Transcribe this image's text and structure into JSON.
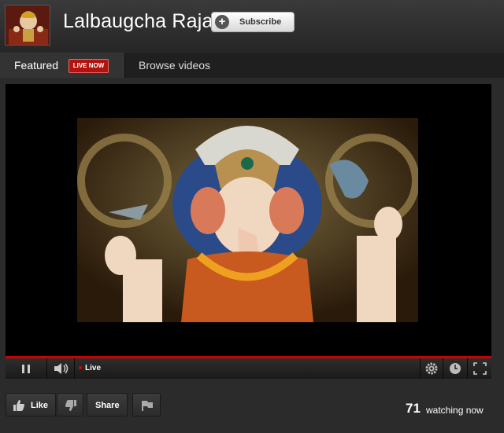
{
  "channel": {
    "title": "Lalbaugcha Raja",
    "subscribe_label": "Subscribe"
  },
  "tabs": {
    "featured_label": "Featured",
    "live_badge": "LIVE NOW",
    "browse_label": "Browse videos"
  },
  "player": {
    "live_label": "Live",
    "icons": [
      "pause-icon",
      "volume-icon",
      "gear-icon",
      "clock-icon",
      "fullscreen-icon"
    ]
  },
  "actions": {
    "like_label": "Like",
    "share_label": "Share",
    "watching_count": "71",
    "watching_label": "watching now"
  },
  "colors": {
    "background": "#2b2b2b",
    "live_red": "#b3130f",
    "progress_red": "#cc0000"
  }
}
